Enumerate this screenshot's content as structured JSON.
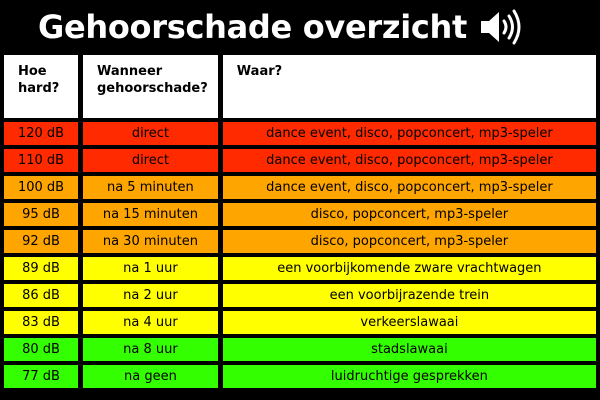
{
  "title": "Gehoorschade overzicht",
  "icon": "speaker-volume-icon",
  "colors": {
    "red": "#ff2a00",
    "orange": "#ffa500",
    "yellow": "#ffff00",
    "green": "#33ff00"
  },
  "headers": [
    "Hoe hard?",
    "Wanneer gehoorschade?",
    "Waar?"
  ],
  "rows": [
    {
      "level": "120 dB",
      "when": "direct",
      "where": "dance event, disco, popconcert, mp3-speler",
      "color": "#ff2a00"
    },
    {
      "level": "110 dB",
      "when": "direct",
      "where": "dance event, disco, popconcert, mp3-speler",
      "color": "#ff2a00"
    },
    {
      "level": "100 dB",
      "when": "na 5 minuten",
      "where": "dance event, disco, popconcert, mp3-speler",
      "color": "#ffa500"
    },
    {
      "level": "95 dB",
      "when": "na 15 minuten",
      "where": "disco, popconcert, mp3-speler",
      "color": "#ffa500"
    },
    {
      "level": "92 dB",
      "when": "na 30 minuten",
      "where": "disco, popconcert, mp3-speler",
      "color": "#ffa500"
    },
    {
      "level": "89 dB",
      "when": "na 1 uur",
      "where": "een voorbijkomende zware vrachtwagen",
      "color": "#ffff00"
    },
    {
      "level": "86 dB",
      "when": "na 2 uur",
      "where": "een voorbijrazende trein",
      "color": "#ffff00"
    },
    {
      "level": "83 dB",
      "when": "na 4 uur",
      "where": "verkeerslawaai",
      "color": "#ffff00"
    },
    {
      "level": "80 dB",
      "when": "na 8 uur",
      "where": "stadslawaai",
      "color": "#33ff00"
    },
    {
      "level": "77 dB",
      "when": "na geen",
      "where": "luidruchtige gesprekken",
      "color": "#33ff00"
    }
  ]
}
